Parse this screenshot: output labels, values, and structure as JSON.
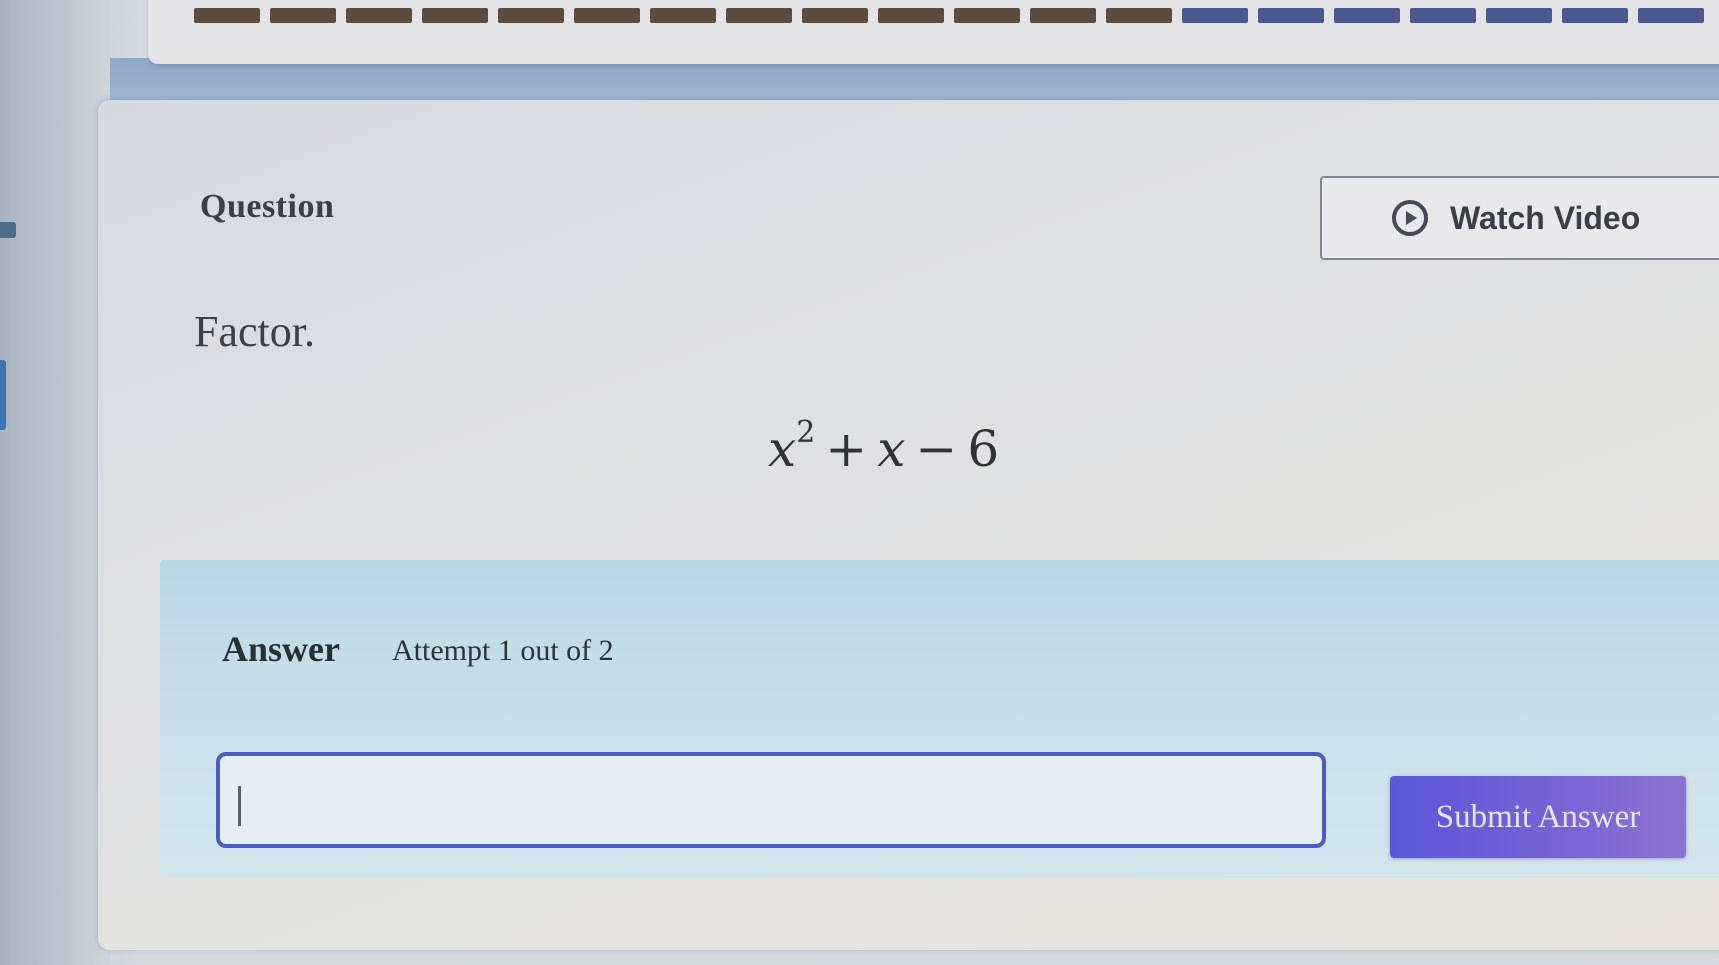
{
  "progress": {
    "completed_segments": 13,
    "remaining_segments": 7,
    "colors": {
      "completed": "#5c4c3e",
      "remaining": "#4a5a90"
    }
  },
  "question": {
    "heading": "Question",
    "watch_video_label": "Watch Video",
    "watch_video_icon": "play-circle-icon",
    "prompt": "Factor.",
    "expression": {
      "term1_var": "x",
      "term1_exponent": "2",
      "op1": "+",
      "term2_var": "x",
      "op2": "−",
      "constant": "6"
    }
  },
  "answer": {
    "heading": "Answer",
    "attempt_text": "Attempt 1 out of 2",
    "input_value": "",
    "submit_label": "Submit Answer"
  },
  "colors": {
    "accent": "#5a56d8",
    "input_border": "#4a5bc4",
    "answer_panel": "#c6dee9"
  }
}
